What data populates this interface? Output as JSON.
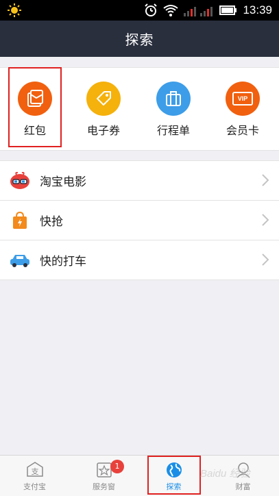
{
  "status_bar": {
    "time": "13:39"
  },
  "nav": {
    "title": "探索"
  },
  "grid": [
    {
      "label": "红包",
      "icon": "red-envelope-icon",
      "color": "#f1600f"
    },
    {
      "label": "电子券",
      "icon": "coupon-tag-icon",
      "color": "#f5b10c"
    },
    {
      "label": "行程单",
      "icon": "luggage-icon",
      "color": "#3d9de8"
    },
    {
      "label": "会员卡",
      "icon": "vip-card-icon",
      "color": "#f1600f",
      "badge_text": "VIP"
    }
  ],
  "list": [
    {
      "label": "淘宝电影",
      "icon": "taobao-movie-icon"
    },
    {
      "label": "快抢",
      "icon": "shopping-bag-icon"
    },
    {
      "label": "快的打车",
      "icon": "taxi-icon"
    }
  ],
  "tabs": [
    {
      "label": "支付宝",
      "icon": "alipay-icon",
      "active": false
    },
    {
      "label": "服务窗",
      "icon": "service-window-icon",
      "active": false,
      "badge": "1"
    },
    {
      "label": "探索",
      "icon": "globe-icon",
      "active": true
    },
    {
      "label": "财富",
      "icon": "wealth-icon",
      "active": false
    }
  ],
  "watermark": "Baidu 经验",
  "colors": {
    "nav_bg": "#2a2f3e",
    "accent_blue": "#1a8ee6",
    "highlight_red": "#e02020"
  }
}
